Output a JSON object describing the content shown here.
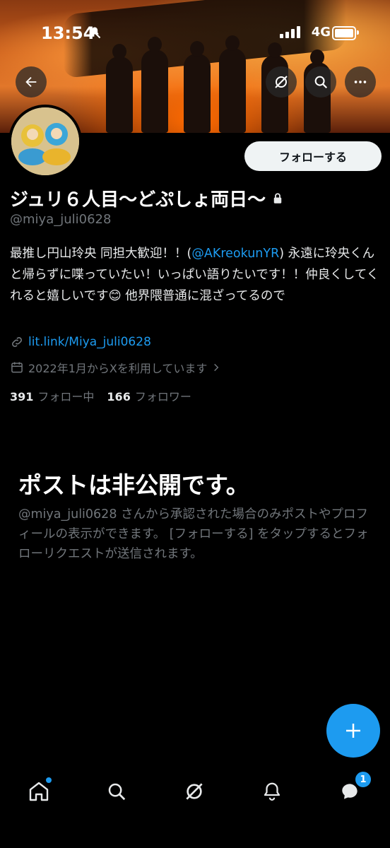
{
  "status_bar": {
    "time": "13:54",
    "network": "4G"
  },
  "profile": {
    "name": "ジュリ６人目〜どぷしょ両日〜",
    "handle": "@miya_juli0628",
    "bio_before": "最推し円山玲央 同担大歓迎！！(",
    "bio_mention": "@AKreokunYR",
    "bio_after": ") 永遠に玲央くんと帰らずに喋っていたい！いっぱい語りたいです！！仲良くしてくれると嬉しいです😊 他界隈普通に混ざってるので",
    "link": "lit.link/Miya_juli0628",
    "joined": "2022年1月からXを利用しています",
    "following_count": "391",
    "following_label": "フォロー中",
    "followers_count": "166",
    "followers_label": "フォロワー"
  },
  "actions": {
    "follow_label": "フォローする"
  },
  "private_notice": {
    "title": "ポストは非公開です。",
    "description": "@miya_juli0628 さんから承認された場合のみポストやプロフィールの表示ができます。 [フォローする] をタップするとフォローリクエストが送信されます。"
  },
  "nav": {
    "messages_badge": "1"
  },
  "colors": {
    "accent": "#1d9bf0",
    "background": "#000000",
    "muted": "#71767b"
  }
}
